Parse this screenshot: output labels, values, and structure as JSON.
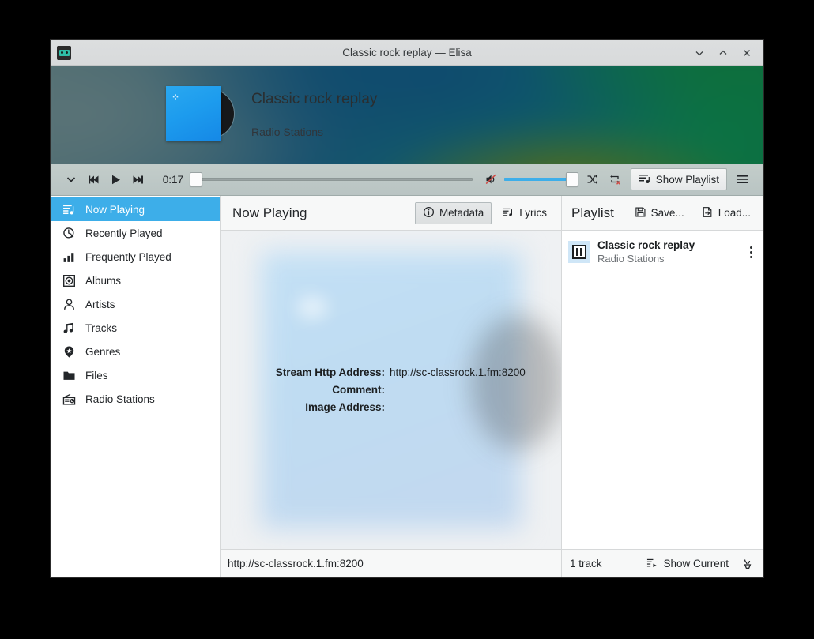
{
  "window": {
    "title": "Classic rock replay — Elisa",
    "app_icon": "cassette-icon",
    "controls": {
      "minimize": "minimize-icon",
      "maximize": "maximize-icon",
      "close": "close-icon"
    }
  },
  "banner": {
    "title": "Classic rock replay",
    "subtitle": "Radio Stations",
    "album_art": "radio-station-cover"
  },
  "player": {
    "menu_icon": "chevron-down-icon",
    "previous_icon": "skip-previous-icon",
    "play_icon": "play-icon",
    "next_icon": "skip-next-icon",
    "elapsed_time": "0:17",
    "progress_percent": 0,
    "volume_icon": "volume-muted-icon",
    "volume_percent": 100,
    "shuffle_icon": "shuffle-icon",
    "repeat_icon": "repeat-off-icon",
    "show_playlist_label": "Show Playlist",
    "show_playlist_icon": "playlist-icon",
    "menu_button_icon": "hamburger-icon"
  },
  "sidebar": {
    "items": [
      {
        "label": "Now Playing",
        "icon": "now-playing-icon",
        "active": true
      },
      {
        "label": "Recently Played",
        "icon": "clock-icon",
        "active": false
      },
      {
        "label": "Frequently Played",
        "icon": "bar-chart-icon",
        "active": false
      },
      {
        "label": "Albums",
        "icon": "album-icon",
        "active": false
      },
      {
        "label": "Artists",
        "icon": "person-icon",
        "active": false
      },
      {
        "label": "Tracks",
        "icon": "music-note-icon",
        "active": false
      },
      {
        "label": "Genres",
        "icon": "genre-pin-icon",
        "active": false
      },
      {
        "label": "Files",
        "icon": "folder-icon",
        "active": false
      },
      {
        "label": "Radio Stations",
        "icon": "radio-icon",
        "active": false
      }
    ]
  },
  "main": {
    "header_title": "Now Playing",
    "tabs": [
      {
        "label": "Metadata",
        "icon": "info-icon",
        "active": true
      },
      {
        "label": "Lyrics",
        "icon": "lyrics-icon",
        "active": false
      }
    ],
    "metadata": [
      {
        "key": "Stream Http Address:",
        "value": "http://sc-classrock.1.fm:8200"
      },
      {
        "key": "Comment:",
        "value": ""
      },
      {
        "key": "Image Address:",
        "value": ""
      }
    ],
    "status_bar": "http://sc-classrock.1.fm:8200"
  },
  "playlist": {
    "title": "Playlist",
    "save_label": "Save...",
    "save_icon": "floppy-save-icon",
    "load_label": "Load...",
    "load_icon": "document-open-icon",
    "tracks": [
      {
        "title": "Classic rock replay",
        "artist": "Radio Stations",
        "state_icon": "pause-icon",
        "menu_icon": "kebab-menu-icon"
      }
    ],
    "footer": {
      "count_label": "1 track",
      "show_current_label": "Show Current",
      "show_current_icon": "show-current-icon",
      "clear_icon": "clear-playlist-icon"
    }
  },
  "colors": {
    "accent": "#3daee9",
    "text": "#232629",
    "window_bg": "#eff0f1",
    "titlebar_bg": "#d8dadb"
  }
}
